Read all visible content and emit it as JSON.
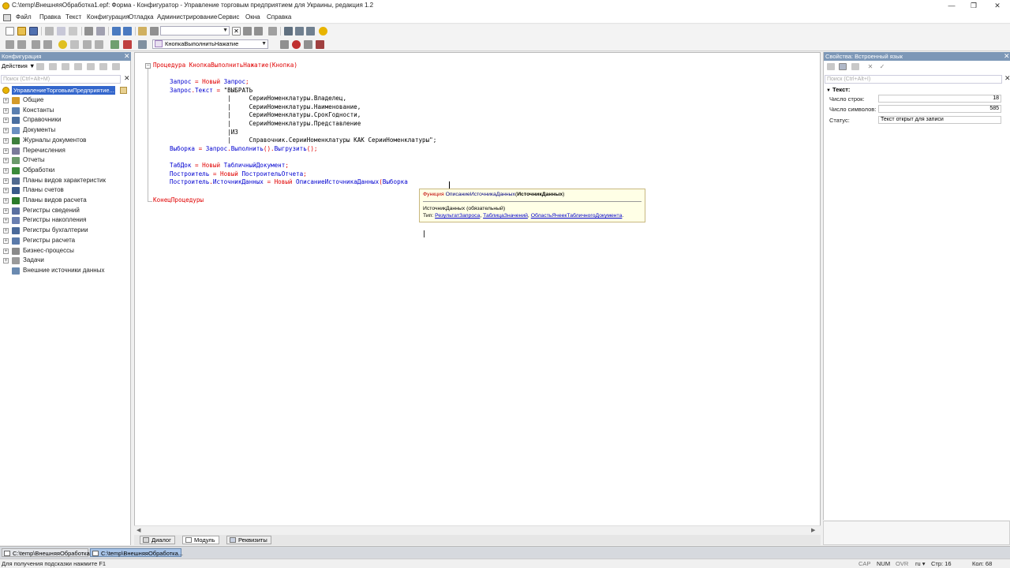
{
  "window": {
    "title": "C:\\temp\\ВнешняяОбработка1.epf: Форма - Конфигуратор - Управление торговым предприятием для Украины, редакция 1.2"
  },
  "menu": [
    "Файл",
    "Правка",
    "Текст",
    "Конфигурация",
    "Отладка",
    "Администрирование",
    "Сервис",
    "Окна",
    "Справка"
  ],
  "toolbar": {
    "search_value": "",
    "procedure_combo": "КнопкаВыполнитьНажатие"
  },
  "config_panel": {
    "header": "Конфигурация",
    "actions_label": "Действия",
    "search_placeholder": "Поиск (Ctrl+Alt+M)",
    "root": "УправлениеТорговымПредприятие...",
    "items": [
      {
        "label": "Общие",
        "icon": "general-icon",
        "color": "#d49a2a"
      },
      {
        "label": "Константы",
        "icon": "constants-icon",
        "color": "#5a7fb0"
      },
      {
        "label": "Справочники",
        "icon": "catalogs-icon",
        "color": "#4a6fa0"
      },
      {
        "label": "Документы",
        "icon": "documents-icon",
        "color": "#6a8fc0"
      },
      {
        "label": "Журналы документов",
        "icon": "journals-icon",
        "color": "#3d7f3d"
      },
      {
        "label": "Перечисления",
        "icon": "enums-icon",
        "color": "#7a7a9a"
      },
      {
        "label": "Отчеты",
        "icon": "reports-icon",
        "color": "#6a9a6a"
      },
      {
        "label": "Обработки",
        "icon": "processing-icon",
        "color": "#3a8a3a"
      },
      {
        "label": "Планы видов характеристик",
        "icon": "chart-of-characteristics-icon",
        "color": "#506a90"
      },
      {
        "label": "Планы счетов",
        "icon": "chart-of-accounts-icon",
        "color": "#3a5a8a"
      },
      {
        "label": "Планы видов расчета",
        "icon": "calculation-types-icon",
        "color": "#2a7a2a"
      },
      {
        "label": "Регистры сведений",
        "icon": "info-registers-icon",
        "color": "#5a6fa0"
      },
      {
        "label": "Регистры накопления",
        "icon": "accumulation-registers-icon",
        "color": "#6a7fb0"
      },
      {
        "label": "Регистры бухгалтерии",
        "icon": "accounting-registers-icon",
        "color": "#4a6a9a"
      },
      {
        "label": "Регистры расчета",
        "icon": "calculation-registers-icon",
        "color": "#5a7aaa"
      },
      {
        "label": "Бизнес-процессы",
        "icon": "business-process-icon",
        "color": "#8a8a8a"
      },
      {
        "label": "Задачи",
        "icon": "tasks-icon",
        "color": "#9a9a9a"
      },
      {
        "label": "Внешние источники данных",
        "icon": "external-sources-icon",
        "color": "#6a8ab0"
      }
    ]
  },
  "code": {
    "proc_start": "Процедура",
    "proc_name": "КнопкаВыполнитьНажатие",
    "proc_args": "(Кнопка)",
    "lines": [
      [
        {
          "t": "Запрос",
          "c": "id"
        },
        {
          "t": " = ",
          "c": "kw"
        },
        {
          "t": "Новый",
          "c": "kw"
        },
        {
          "t": " Запрос",
          "c": "id"
        },
        {
          "t": ";",
          "c": "kw"
        }
      ],
      [
        {
          "t": "Запрос",
          "c": "id"
        },
        {
          "t": ".",
          "c": "kw"
        },
        {
          "t": "Текст",
          "c": "id"
        },
        {
          "t": " = ",
          "c": "kw"
        },
        {
          "t": "\"ВЫБРАТЬ",
          "c": "str"
        }
      ],
      [
        {
          "t": "                |     СерииНоменклатуры.Владелец,",
          "c": "str"
        }
      ],
      [
        {
          "t": "                |     СерииНоменклатуры.Наименование,",
          "c": "str"
        }
      ],
      [
        {
          "t": "                |     СерииНоменклатуры.СрокГодности,",
          "c": "str"
        }
      ],
      [
        {
          "t": "                |     СерииНоменклатуры.Представление",
          "c": "str"
        }
      ],
      [
        {
          "t": "                |ИЗ",
          "c": "str"
        }
      ],
      [
        {
          "t": "                |     Справочник.СерииНоменклатуры КАК СерииНоменклатуры\";",
          "c": "str"
        }
      ],
      [
        {
          "t": "Выборка",
          "c": "id"
        },
        {
          "t": " = ",
          "c": "kw"
        },
        {
          "t": "Запрос",
          "c": "id"
        },
        {
          "t": ".",
          "c": "kw"
        },
        {
          "t": "Выполнить",
          "c": "id"
        },
        {
          "t": "().",
          "c": "kw"
        },
        {
          "t": "Выгрузить",
          "c": "id"
        },
        {
          "t": "();",
          "c": "kw"
        }
      ],
      [],
      [
        {
          "t": "ТабДок",
          "c": "id"
        },
        {
          "t": " = ",
          "c": "kw"
        },
        {
          "t": "Новый",
          "c": "kw"
        },
        {
          "t": " ТабличныйДокумент",
          "c": "id"
        },
        {
          "t": ";",
          "c": "kw"
        }
      ],
      [
        {
          "t": "Построитель",
          "c": "id"
        },
        {
          "t": " = ",
          "c": "kw"
        },
        {
          "t": "Новый",
          "c": "kw"
        },
        {
          "t": " ПостроительОтчета",
          "c": "id"
        },
        {
          "t": ";",
          "c": "kw"
        }
      ],
      [
        {
          "t": "Построитель",
          "c": "id"
        },
        {
          "t": ".",
          "c": "kw"
        },
        {
          "t": "ИсточникДанных",
          "c": "id"
        },
        {
          "t": " = ",
          "c": "kw"
        },
        {
          "t": "Новый",
          "c": "kw"
        },
        {
          "t": " ОписаниеИсточникаДанных",
          "c": "id"
        },
        {
          "t": "(",
          "c": "kw"
        },
        {
          "t": "Выборка",
          "c": "id"
        }
      ]
    ],
    "proc_end": "КонецПроцедуры"
  },
  "tooltip": {
    "func_prefix": "Функция",
    "func_name": "ОписаниеИсточникаДанных",
    "func_param_open": "(",
    "func_param": "ИсточникДанных",
    "func_param_close": ")",
    "param_desc": "ИсточникДанных (обязательный)",
    "type_prefix": "Тип:",
    "types": [
      "РезультатЗапроса",
      "ТаблицаЗначений",
      "ОбластьЯчеекТабличногоДокумента"
    ],
    "type_sep": ", ",
    "type_end": "."
  },
  "bottom_tabs": [
    "Диалог",
    "Модуль",
    "Реквизиты"
  ],
  "properties": {
    "header": "Свойства: Встроенный язык",
    "search_placeholder": "Поиск (Ctrl+Alt+I)",
    "group": "Текст:",
    "rows": [
      {
        "label": "Число строк:",
        "value": "18"
      },
      {
        "label": "Число символов:",
        "value": "585"
      },
      {
        "label": "Статус:",
        "value": "Текст открыт для записи"
      }
    ]
  },
  "taskbar": [
    "C:\\temp\\ВнешняяОбработка...",
    "C:\\temp\\ВнешняяОбработка..."
  ],
  "status": {
    "hint": "Для получения подсказки нажмите F1",
    "cap": "CAP",
    "num": "NUM",
    "ovr": "OVR",
    "lang": "ru",
    "line": "Стр: 16",
    "col": "Кол: 68"
  },
  "colors": {
    "keyword": "#e00000",
    "identifier": "#0000d0",
    "panel_header": "#7c97b7",
    "selection": "#3366cc"
  }
}
